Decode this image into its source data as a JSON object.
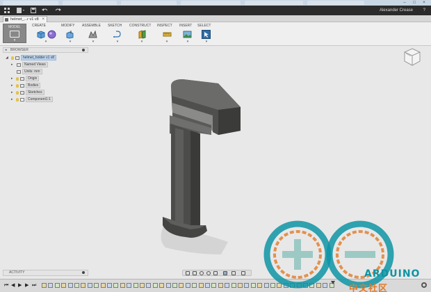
{
  "app": {
    "user_name": "Alexander Crease",
    "help_label": "?"
  },
  "document_tab": {
    "title": "helmet_...r v1 v8",
    "close_glyph": "×"
  },
  "workspace": {
    "label": "MODEL",
    "caret": "▾",
    "icon": "model-workspace-icon"
  },
  "toolbar": {
    "groups": [
      {
        "label": "CREATE",
        "icons": [
          "extrude-icon",
          "sphere-icon"
        ]
      },
      {
        "label": "MODIFY",
        "icons": [
          "press-pull-icon"
        ]
      },
      {
        "label": "ASSEMBLE",
        "icons": [
          "joint-icon"
        ]
      },
      {
        "label": "SKETCH",
        "icons": [
          "sketch-icon"
        ]
      },
      {
        "label": "CONSTRUCT",
        "icons": [
          "plane-icon"
        ]
      },
      {
        "label": "INSPECT",
        "icons": [
          "measure-icon"
        ]
      },
      {
        "label": "INSERT",
        "icons": [
          "insert-image-icon"
        ]
      },
      {
        "label": "SELECT",
        "icons": [
          "select-icon"
        ]
      }
    ],
    "caret": "▾"
  },
  "browser": {
    "header": "BROWSER",
    "collapse_glyph": "◂",
    "root": "helmet_holder v1 v8",
    "items": [
      {
        "label": "Named Views"
      },
      {
        "label": "Units: mm"
      },
      {
        "label": "Origin"
      },
      {
        "label": "Bodies"
      },
      {
        "label": "Sketches"
      },
      {
        "label": "Component1:1"
      }
    ]
  },
  "activity": {
    "header": "ACTIVITY"
  },
  "timeline": {
    "controls": [
      "⏮",
      "◀",
      "▶",
      "▶",
      "⏭"
    ]
  },
  "watermark": {
    "brand": "ARDUINO",
    "subtitle": "中文社区"
  },
  "colors": {
    "accent": "#0696d7",
    "selection": "#b8d3ef",
    "model_body": "#4a4a48",
    "watermark_teal": "#0e94a4",
    "watermark_orange": "#e07a28"
  }
}
